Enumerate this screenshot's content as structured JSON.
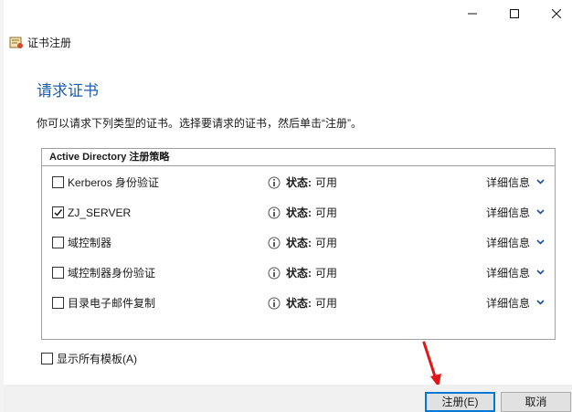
{
  "window": {
    "title": "证书注册",
    "controls": [
      "minimize-icon",
      "maximize-icon",
      "close-icon"
    ]
  },
  "main": {
    "heading": "请求证书",
    "description": "你可以请求下列类型的证书。选择要请求的证书，然后单击“注册”。"
  },
  "group": {
    "title": "Active Directory 注册策略",
    "rows": [
      {
        "name": "Kerberos 身份验证",
        "checked": false,
        "status_label": "状态:",
        "status_value": "可用",
        "details_label": "详细信息"
      },
      {
        "name": "ZJ_SERVER",
        "checked": true,
        "status_label": "状态:",
        "status_value": "可用",
        "details_label": "详细信息"
      },
      {
        "name": "域控制器",
        "checked": false,
        "status_label": "状态:",
        "status_value": "可用",
        "details_label": "详细信息"
      },
      {
        "name": "域控制器身份验证",
        "checked": false,
        "status_label": "状态:",
        "status_value": "可用",
        "details_label": "详细信息"
      },
      {
        "name": "目录电子邮件复制",
        "checked": false,
        "status_label": "状态:",
        "status_value": "可用",
        "details_label": "详细信息"
      }
    ]
  },
  "options": {
    "show_all_label": "显示所有模板(A)",
    "show_all_checked": false
  },
  "buttons": {
    "register": "注册(E)",
    "cancel": "取消"
  },
  "colors": {
    "heading": "#1d5eab",
    "accent": "#0078d7",
    "arrow": "#e0161b",
    "chevron": "#1a4fa0"
  }
}
